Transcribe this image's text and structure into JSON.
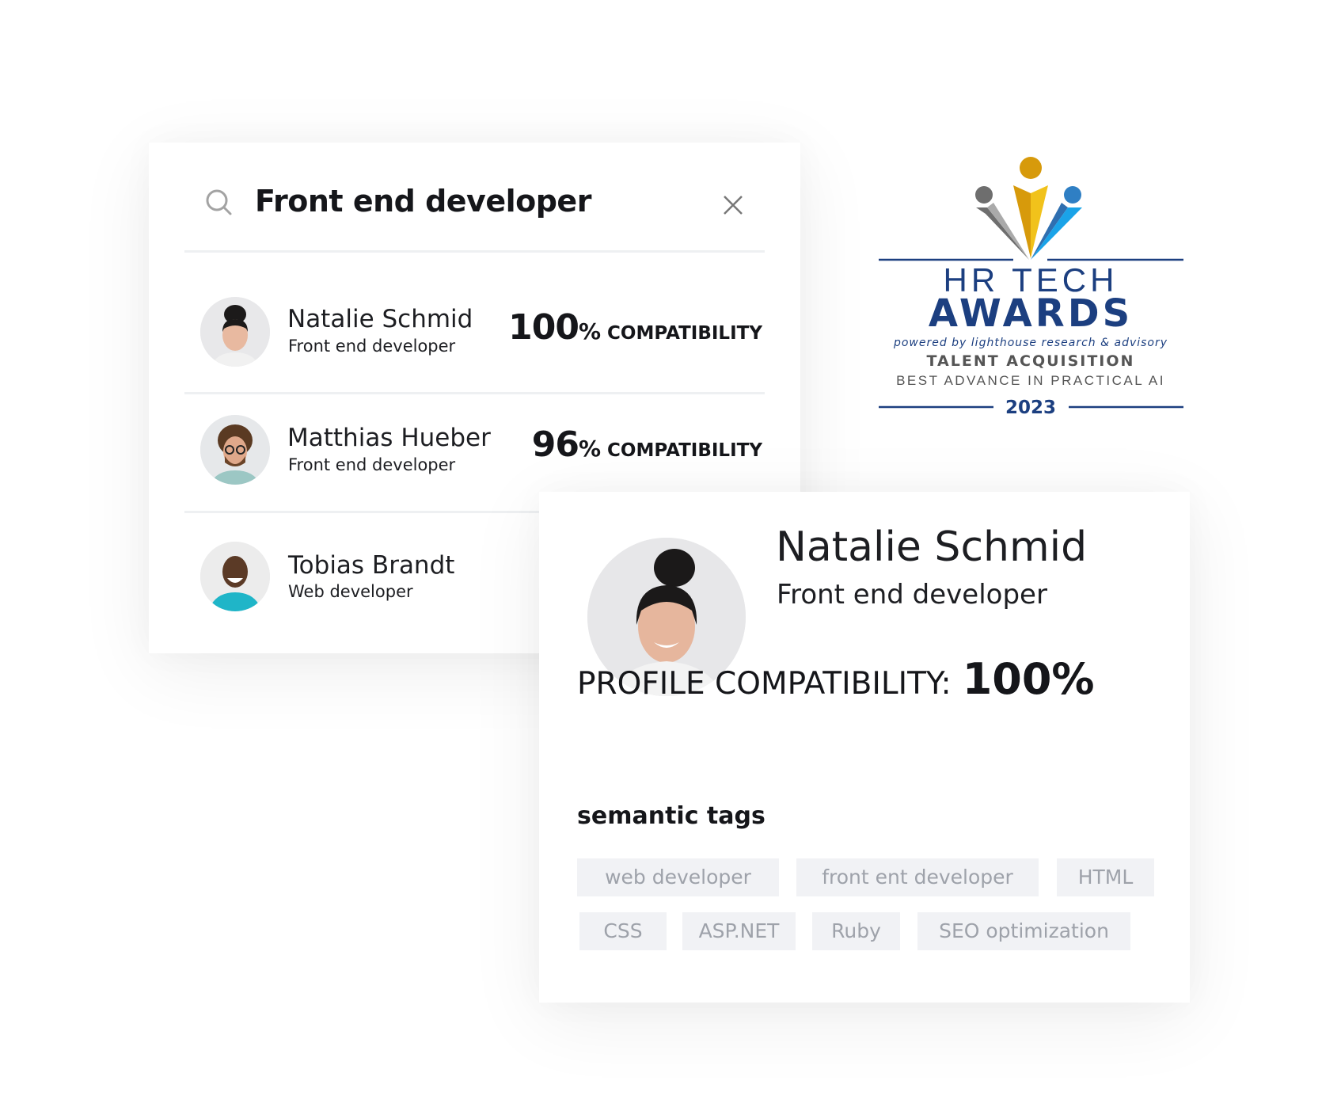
{
  "search": {
    "query": "Front end developer",
    "icon": "search-icon",
    "clear_icon": "close-icon"
  },
  "results": [
    {
      "name": "Natalie Schmid",
      "role": "Front end developer",
      "score": "100",
      "percent_sign": "%",
      "compat_label": "COMPATIBILITY"
    },
    {
      "name": "Matthias Hueber",
      "role": "Front end developer",
      "score": "96",
      "percent_sign": "%",
      "compat_label": "COMPATIBILITY"
    },
    {
      "name": "Tobias Brandt",
      "role": "Web developer"
    }
  ],
  "profile": {
    "name": "Natalie Schmid",
    "role": "Front end developer",
    "compat_label": "PROFILE COMPATIBILITY:",
    "compat_value": "100%",
    "tags_title": "semantic tags",
    "tags": [
      "web developer",
      "front ent developer",
      "HTML",
      "CSS",
      "ASP.NET",
      "Ruby",
      "SEO optimization"
    ]
  },
  "award": {
    "line1": "HR TECH",
    "line2": "AWARDS",
    "powered": "powered by lighthouse research & advisory",
    "category": "TALENT ACQUISITION",
    "subcategory": "BEST ADVANCE IN PRACTICAL AI",
    "year": "2023"
  },
  "colors": {
    "award_blue": "#1c3f80",
    "award_gold": "#e0a816",
    "award_gray": "#6e6e6e",
    "award_light_blue": "#2b8fd8",
    "tag_bg": "#f1f2f5",
    "tag_text": "#9ea2aa"
  }
}
